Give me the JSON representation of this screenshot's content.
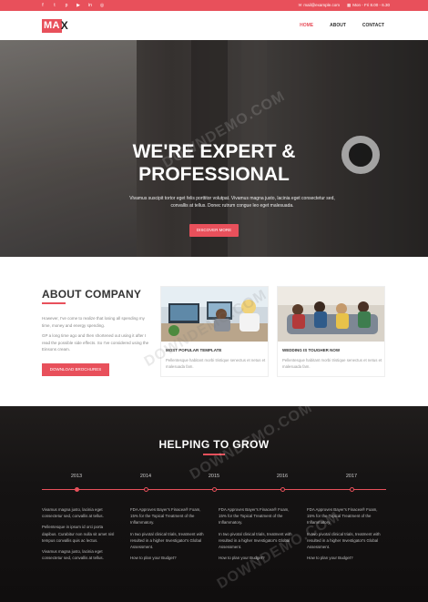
{
  "topbar": {
    "social_icons": [
      "facebook-icon",
      "twitter-icon",
      "pinterest-icon",
      "youtube-icon",
      "linkedin-icon",
      "dribbble-icon"
    ],
    "social_glyphs": [
      "f",
      "t",
      "p",
      "▶",
      "in",
      "◎"
    ],
    "email": "mail@example.com",
    "hours": "Mon - Fri 8.00 - 6.30"
  },
  "nav": {
    "logo_text": "MA",
    "logo_accent": "X",
    "items": [
      "HOME",
      "ABOUT",
      "CONTACT"
    ],
    "active": "HOME"
  },
  "hero": {
    "title_line1": "WE'RE EXPERT &",
    "title_line2": "PROFESSIONAL",
    "text": "Vivamus suscipit tortor eget felis porttitor volutpat. Vivamus magna justo, lacinia eget consectetur sed, convallis at tellus. Donec rutrum congue leo eget malesuada.",
    "button": "DISCOVER MORE"
  },
  "about": {
    "title": "ABOUT COMPANY",
    "para1": "However, I've come to realize that losing all spending my time, money and energy spending.",
    "para2": "GP a long time ago and then shortened out using it after I read the possible side effects. So I've considered using the Einsons cream.",
    "button": "DOWNLOAD BROCHURES",
    "cards": [
      {
        "title": "MOST POPULAR TEMPLATE",
        "text": "Pellentesque habitant morbi tristique senectus et netus et malesuada fam."
      },
      {
        "title": "WEDDING IS TOUGHER NOW",
        "text": "Pellentesque habitant morbi tristique senectus et netus et malesuada fam."
      }
    ]
  },
  "timeline": {
    "title": "HELPING TO GROW",
    "years": [
      "2013",
      "2014",
      "2015",
      "2016",
      "2017"
    ],
    "columns": [
      [
        "Vivamus magna justo, lacinia eget consectetur sed, convallis at tellus.",
        "Pellentesque in ipsum id orci porta dapibus. Curabitur non nulla sit amet nisl tempus convallis quis ac lectus.",
        "Vivamus magna justo, lacinia eget consectetur sed, convallis at tellus."
      ],
      [
        "FDA Approves Bayer's Finacea® Foam, 15% for the Topical Treatment of the Inflammatory.",
        "In two pivotal clinical trials, treatment with resulted in a higher Investigator's Global Assessment.",
        "How to plan your Budget?"
      ],
      [
        "FDA Approves Bayer's Finacea® Foam, 15% for the Topical Treatment of the Inflammatory.",
        "In two pivotal clinical trials, treatment with resulted in a higher Investigator's Global Assessment.",
        "How to plan your Budget?"
      ],
      [
        "FDA Approves Bayer's Finacea® Foam, 15% for the Topical Treatment of the Inflammatory.",
        "In two pivotal clinical trials, treatment with resulted in a higher Investigator's Global Assessment.",
        "How to plan your Budget?"
      ]
    ]
  },
  "watermark": "DOWNDEMO.COM",
  "colors": {
    "accent": "#e8505b",
    "dark_bg": "#151313"
  }
}
